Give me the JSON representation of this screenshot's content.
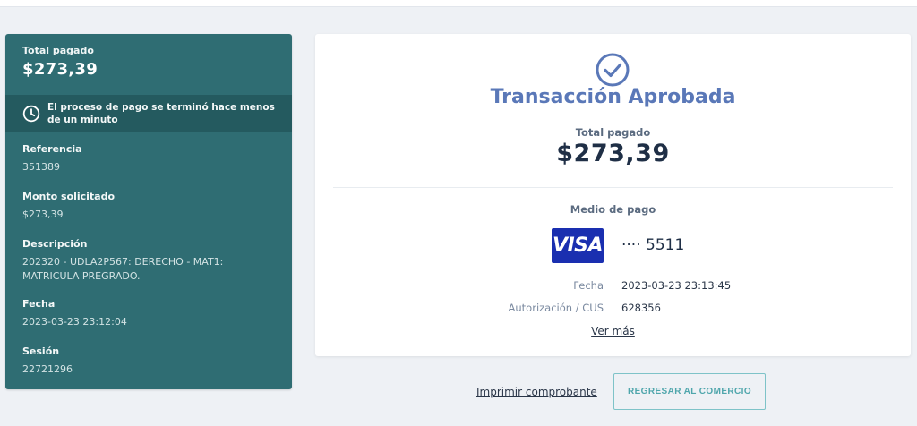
{
  "summary": {
    "total_label": "Total pagado",
    "total_value": "$273,39",
    "notice": "El proceso de pago se terminó hace menos de un minuto",
    "fields": [
      {
        "label": "Referencia",
        "value": "351389"
      },
      {
        "label": "Monto solicitado",
        "value": "$273,39"
      },
      {
        "label": "Descripción",
        "value": "202320 - UDLA2P567: DERECHO - MAT1: MATRICULA PREGRADO."
      },
      {
        "label": "Fecha",
        "value": "2023-03-23 23:12:04"
      },
      {
        "label": "Sesión",
        "value": "22721296"
      }
    ]
  },
  "card": {
    "title": "Transacción Aprobada",
    "total_label": "Total pagado",
    "total_value": "$273,39",
    "method_label": "Medio de pago",
    "card_brand": "VISA",
    "card_digits": "···· 5511",
    "rows": [
      {
        "label": "Fecha",
        "value": "2023-03-23 23:13:45"
      },
      {
        "label": "Autorización / CUS",
        "value": "628356"
      }
    ],
    "more_link": "Ver más"
  },
  "actions": {
    "print_label": "Imprimir comprobante",
    "return_label": "REGRESAR AL COMERCIO"
  },
  "colors": {
    "panel": "#2f6d73",
    "accent": "#5a78b8",
    "visa": "#1a2fb0"
  }
}
